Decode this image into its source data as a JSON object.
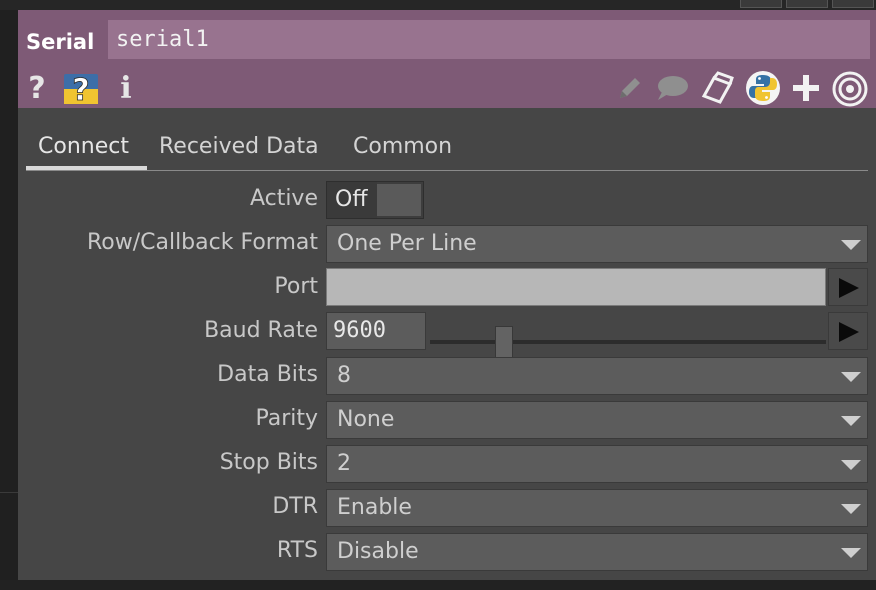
{
  "header": {
    "operator_type": "Serial",
    "operator_name": "serial1",
    "left_icons": [
      "help-icon",
      "python-help-icon",
      "info-icon"
    ],
    "right_icons": [
      "edit-icon",
      "comment-icon",
      "clone-icon",
      "python-icon",
      "add-icon",
      "target-icon"
    ]
  },
  "tabs": [
    {
      "label": "Connect",
      "active": true
    },
    {
      "label": "Received Data",
      "active": false
    },
    {
      "label": "Common",
      "active": false
    }
  ],
  "params": {
    "active": {
      "label": "Active",
      "value": "Off"
    },
    "row_callback_format": {
      "label": "Row/Callback Format",
      "value": "One Per Line"
    },
    "port": {
      "label": "Port",
      "value": ""
    },
    "baud_rate": {
      "label": "Baud Rate",
      "value": "9600"
    },
    "data_bits": {
      "label": "Data Bits",
      "value": "8"
    },
    "parity": {
      "label": "Parity",
      "value": "None"
    },
    "stop_bits": {
      "label": "Stop Bits",
      "value": "2"
    },
    "dtr": {
      "label": "DTR",
      "value": "Enable"
    },
    "rts": {
      "label": "RTS",
      "value": "Disable"
    }
  },
  "colors": {
    "header": "#7e5a76",
    "name_field": "#98738f",
    "panel": "#464646"
  }
}
